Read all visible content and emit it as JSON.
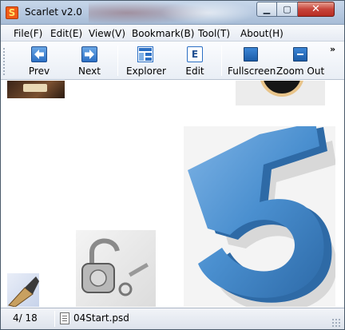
{
  "window": {
    "title": "Scarlet v2.0",
    "app_icon_letter": "S",
    "controls": {
      "minimize": "▁",
      "maximize": "▢",
      "close": "✕"
    }
  },
  "menu": {
    "items": [
      "File(F)",
      "Edit(E)",
      "View(V)",
      "Bookmark(B)",
      "Tool(T)",
      "About(H)"
    ]
  },
  "toolbar": {
    "buttons": [
      {
        "label": "Prev",
        "icon": "arrow-left-icon"
      },
      {
        "label": "Next",
        "icon": "arrow-right-icon"
      },
      {
        "label": "Explorer",
        "icon": "explorer-icon"
      },
      {
        "label": "Edit",
        "icon": "edit-icon"
      },
      {
        "label": "Fullscreen",
        "icon": "fullscreen-icon"
      },
      {
        "label": "Zoom Out",
        "icon": "zoom-out-icon"
      }
    ],
    "overflow": "»",
    "edit_icon_letter": "E"
  },
  "status": {
    "page": "4/ 18",
    "file": "04Start.psd"
  },
  "colors": {
    "accent_blue": "#2b6fc4",
    "five_blue": "#4a8fcf"
  }
}
